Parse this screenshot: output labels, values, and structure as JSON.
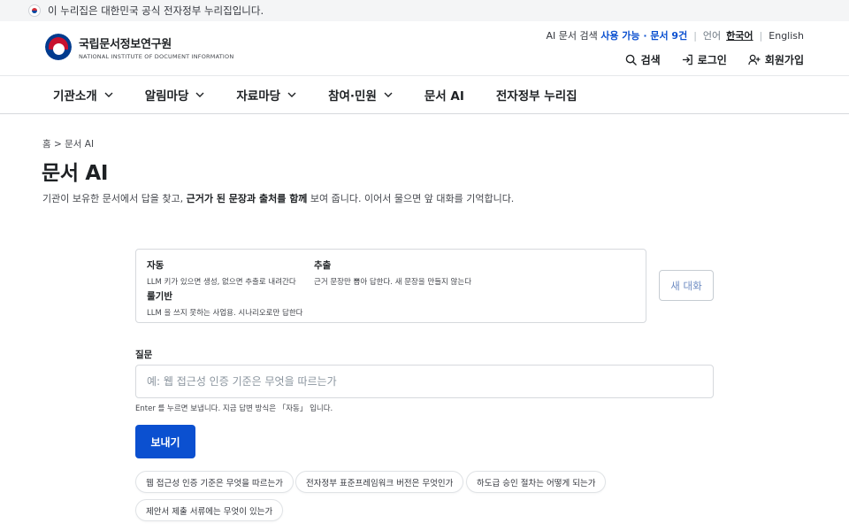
{
  "gov_banner": {
    "text": "이 누리집은 대한민국 공식 전자정부 누리집입니다."
  },
  "header": {
    "logo": {
      "name_ko": "국립문서정보연구원",
      "name_en": "NATIONAL INSTITUTE OF DOCUMENT INFORMATION"
    },
    "util": {
      "ai_search": "AI 문서 검색",
      "available": "사용 가능 · 문서 9건",
      "lang_label": "언어",
      "lang_ko": "한국어",
      "lang_en": "English"
    },
    "actions": {
      "search": "검색",
      "login": "로그인",
      "signup": "회원가입"
    }
  },
  "nav": {
    "items": [
      {
        "label": "기관소개"
      },
      {
        "label": "알림마당"
      },
      {
        "label": "자료마당"
      },
      {
        "label": "참여·민원"
      },
      {
        "label": "문서 AI"
      },
      {
        "label": "전자정부 누리집"
      }
    ]
  },
  "main": {
    "breadcrumb": "홈 > 문서 AI",
    "title": "문서 AI",
    "desc_pre": "기관이 보유한 문서에서 답을 찾고, ",
    "desc_bold": "근거가 된 문장과 출처를 함께",
    "desc_post": " 보여 줍니다. 이어서 물으면 앞 대화를 기억합니다.",
    "modes": [
      {
        "title": "자동",
        "desc": "LLM 키가 있으면 생성, 없으면 추출로 내려간다"
      },
      {
        "title": "추출",
        "desc": "근거 문장만 뽑아 답한다. 새 문장을 만들지 않는다"
      },
      {
        "title": "룰기반",
        "desc": "LLM 을 쓰지 못하는 사업용. 시나리오로만 답한다"
      }
    ],
    "new_chat": "새 대화",
    "question_label": "질문",
    "question_placeholder": "예: 웹 접근성 인증 기준은 무엇을 따르는가",
    "question_value": "",
    "hint": "Enter 를 누르면 보냅니다. 지금 답변 방식은 「자동」 입니다.",
    "send": "보내기",
    "suggestions": [
      "웹 접근성 인증 기준은 무엇을 따르는가",
      "전자정부 표준프레임워크 버전은 무엇인가",
      "하도급 승인 절차는 어떻게 되는가",
      "제안서 제출 서류에는 무엇이 있는가"
    ]
  },
  "colors": {
    "primary": "#0b50d0",
    "text": "#1e2124",
    "border": "#d6d9dd"
  }
}
